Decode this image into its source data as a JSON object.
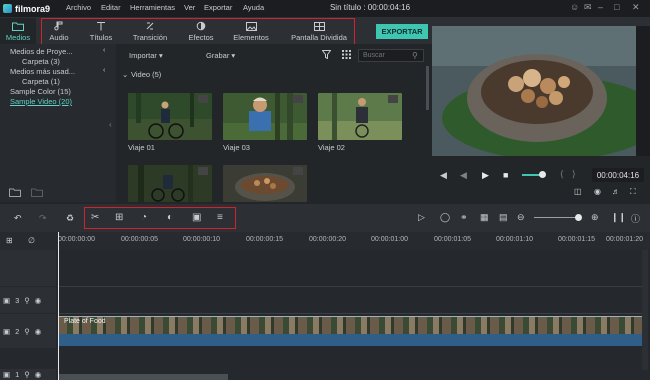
{
  "app": {
    "name": "filmora9",
    "title": "Sin título : 00:00:04:16"
  },
  "menu": [
    "Archivo",
    "Editar",
    "Herramientas",
    "Ver",
    "Exportar",
    "Ayuda"
  ],
  "tabs": [
    {
      "label": "Medios",
      "icon": "folder-icon"
    },
    {
      "label": "Audio",
      "icon": "music-note-icon"
    },
    {
      "label": "Títulos",
      "icon": "text-icon"
    },
    {
      "label": "Transición",
      "icon": "transition-icon"
    },
    {
      "label": "Efectos",
      "icon": "effects-icon"
    },
    {
      "label": "Elementos",
      "icon": "image-icon"
    },
    {
      "label": "Pantalla Dividida",
      "icon": "split-screen-icon"
    }
  ],
  "export_label": "EXPORTAR",
  "library": [
    {
      "label": "Medios de Proye..."
    },
    {
      "label": "Carpeta (3)"
    },
    {
      "label": "Medios más usad..."
    },
    {
      "label": "Carpeta (1)"
    },
    {
      "label": "Sample Color (15)"
    },
    {
      "label": "Sample Video (20)"
    }
  ],
  "subbar": {
    "import": "Importar",
    "record": "Grabar",
    "search_placeholder": "Buscar"
  },
  "section_title": "Video (5)",
  "thumbnails": [
    {
      "label": "Viaje 01"
    },
    {
      "label": "Viaje 03"
    },
    {
      "label": "Viaje 02"
    },
    {
      "label": ""
    },
    {
      "label": ""
    }
  ],
  "preview": {
    "timecode": "00:00:04:16"
  },
  "ruler_ticks": [
    "00:00:00:00",
    "00:00:00:05",
    "00:00:00:10",
    "00:00:00:15",
    "00:00:00:20",
    "00:00:01:00",
    "00:00:01:05",
    "00:00:01:10",
    "00:00:01:15",
    "00:00:01:20"
  ],
  "tracks": [
    {
      "number": "3"
    },
    {
      "number": "2"
    },
    {
      "number": "1"
    }
  ],
  "clip_label": "Plate of Food",
  "colors": {
    "accent": "#3fc6b2",
    "highlight": "#d0232b"
  }
}
